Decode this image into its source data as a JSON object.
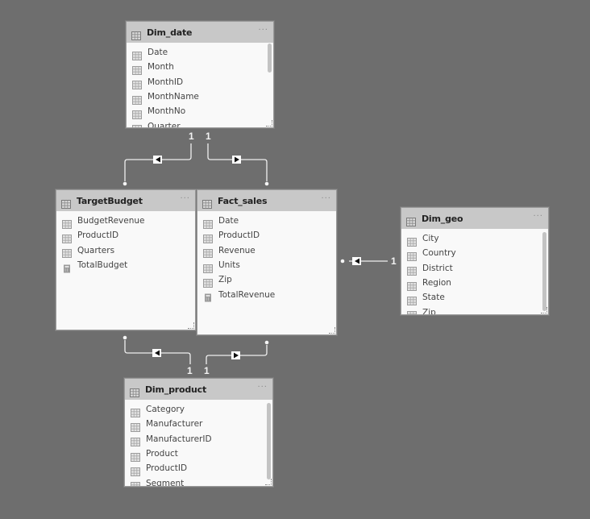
{
  "tables": {
    "dim_date": {
      "name": "Dim_date",
      "more": "···",
      "fields": [
        {
          "name": "Date",
          "type": "column"
        },
        {
          "name": "Month",
          "type": "column"
        },
        {
          "name": "MonthID",
          "type": "column"
        },
        {
          "name": "MonthName",
          "type": "column"
        },
        {
          "name": "MonthNo",
          "type": "column"
        },
        {
          "name": "Quarter",
          "type": "column"
        }
      ]
    },
    "target_budget": {
      "name": "TargetBudget",
      "more": "···",
      "fields": [
        {
          "name": "BudgetRevenue",
          "type": "column"
        },
        {
          "name": "ProductID",
          "type": "column"
        },
        {
          "name": "Quarters",
          "type": "column"
        },
        {
          "name": "TotalBudget",
          "type": "measure"
        }
      ]
    },
    "fact_sales": {
      "name": "Fact_sales",
      "more": "···",
      "fields": [
        {
          "name": "Date",
          "type": "column"
        },
        {
          "name": "ProductID",
          "type": "column"
        },
        {
          "name": "Revenue",
          "type": "column"
        },
        {
          "name": "Units",
          "type": "column"
        },
        {
          "name": "Zip",
          "type": "column"
        },
        {
          "name": "TotalRevenue",
          "type": "measure"
        }
      ]
    },
    "dim_geo": {
      "name": "Dim_geo",
      "more": "···",
      "fields": [
        {
          "name": "City",
          "type": "column"
        },
        {
          "name": "Country",
          "type": "column"
        },
        {
          "name": "District",
          "type": "column"
        },
        {
          "name": "Region",
          "type": "column"
        },
        {
          "name": "State",
          "type": "column"
        },
        {
          "name": "Zip",
          "type": "column"
        }
      ]
    },
    "dim_product": {
      "name": "Dim_product",
      "more": "···",
      "fields": [
        {
          "name": "Category",
          "type": "column"
        },
        {
          "name": "Manufacturer",
          "type": "column"
        },
        {
          "name": "ManufacturerID",
          "type": "column"
        },
        {
          "name": "Product",
          "type": "column"
        },
        {
          "name": "ProductID",
          "type": "column"
        },
        {
          "name": "Segment",
          "type": "column"
        }
      ]
    }
  },
  "relationships": [
    {
      "from": "Dim_date",
      "to": "TargetBudget",
      "one_label": "1",
      "many_label": "*",
      "direction": "left"
    },
    {
      "from": "Dim_date",
      "to": "Fact_sales",
      "one_label": "1",
      "many_label": "*",
      "direction": "right"
    },
    {
      "from": "Dim_geo",
      "to": "Fact_sales",
      "one_label": "1",
      "many_label": "*",
      "direction": "left"
    },
    {
      "from": "Dim_product",
      "to": "TargetBudget",
      "one_label": "1",
      "many_label": "*",
      "direction": "left"
    },
    {
      "from": "Dim_product",
      "to": "Fact_sales",
      "one_label": "1",
      "many_label": "*",
      "direction": "right"
    }
  ],
  "colors": {
    "canvas": "#6e6e6e",
    "header": "#c8c8c8",
    "body": "#f9f9f9",
    "line": "#f0f0f0"
  }
}
